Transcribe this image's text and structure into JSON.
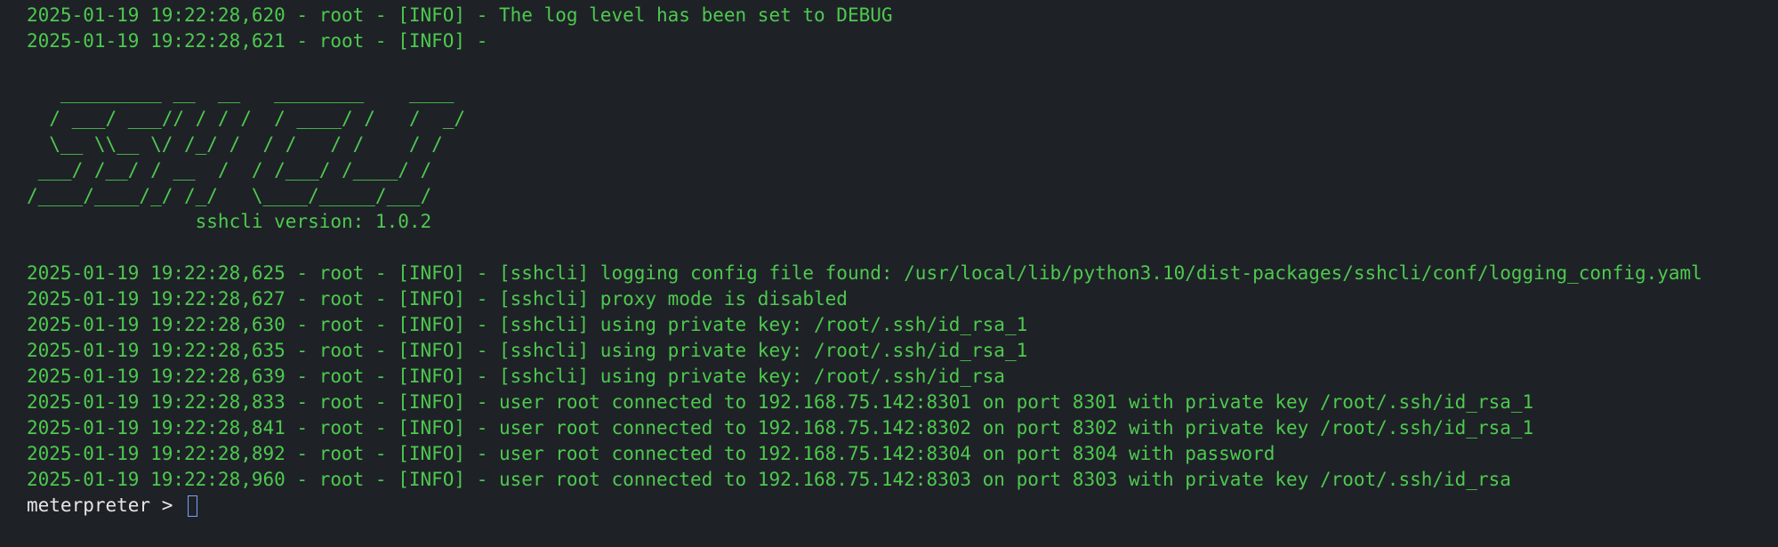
{
  "terminal": {
    "colors": {
      "background": "#1e2227",
      "log_text": "#4ec94e",
      "prompt_text": "#e6e6e6",
      "cursor": "#7aa2f7"
    },
    "pre_lines": [
      "2025-01-19 19:22:28,620 - root - [INFO] - The log level has been set to DEBUG",
      "2025-01-19 19:22:28,621 - root - [INFO] -"
    ],
    "banner": "   _________ __  __   ________    ____\n  / ___/ ___// / / /  / ____/ /   /  _/\n  \\__ \\\\__ \\/ /_/ /  / /   / /    / /  \n ___/ /__/ / __  /  / /___/ /____/ /   \n/____/____/_/ /_/   \\____/_____/___/   \n               sshcli version: 1.0.2",
    "log_lines": [
      "2025-01-19 19:22:28,625 - root - [INFO] - [sshcli] logging config file found: /usr/local/lib/python3.10/dist-packages/sshcli/conf/logging_config.yaml",
      "2025-01-19 19:22:28,627 - root - [INFO] - [sshcli] proxy mode is disabled",
      "2025-01-19 19:22:28,630 - root - [INFO] - [sshcli] using private key: /root/.ssh/id_rsa_1",
      "2025-01-19 19:22:28,635 - root - [INFO] - [sshcli] using private key: /root/.ssh/id_rsa_1",
      "2025-01-19 19:22:28,639 - root - [INFO] - [sshcli] using private key: /root/.ssh/id_rsa",
      "2025-01-19 19:22:28,833 - root - [INFO] - user root connected to 192.168.75.142:8301 on port 8301 with private key /root/.ssh/id_rsa_1",
      "2025-01-19 19:22:28,841 - root - [INFO] - user root connected to 192.168.75.142:8302 on port 8302 with private key /root/.ssh/id_rsa_1",
      "2025-01-19 19:22:28,892 - root - [INFO] - user root connected to 192.168.75.142:8304 on port 8304 with password",
      "2025-01-19 19:22:28,960 - root - [INFO] - user root connected to 192.168.75.142:8303 on port 8303 with private key /root/.ssh/id_rsa"
    ],
    "prompt": "meterpreter > "
  }
}
